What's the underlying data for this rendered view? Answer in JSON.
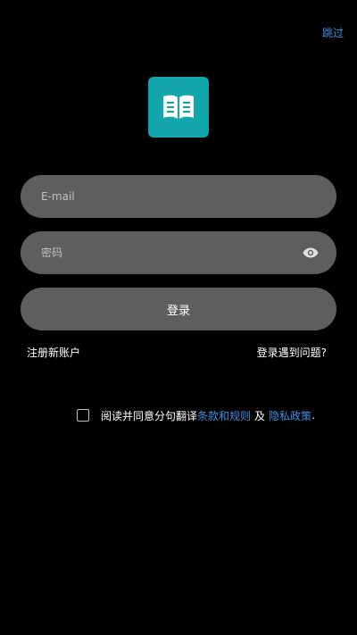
{
  "header": {
    "skip_label": "跳过"
  },
  "logo": {
    "icon": "open-book-icon",
    "color": "#12a6aa"
  },
  "form": {
    "email_placeholder": "E-mail",
    "email_value": "",
    "password_placeholder": "密码",
    "password_value": "",
    "password_toggle_icon": "eye-icon",
    "login_label": "登录"
  },
  "links": {
    "register": "注册新账户",
    "trouble": "登录遇到问题?"
  },
  "agreement": {
    "checked": false,
    "prefix": "阅读并同意分句翻译",
    "terms": "条款和规则",
    "and": "及",
    "privacy": "隐私政策",
    "suffix": "."
  },
  "colors": {
    "background": "#000000",
    "field": "#5e5e5e",
    "link": "#3b8fe0",
    "brand": "#12a6aa"
  }
}
